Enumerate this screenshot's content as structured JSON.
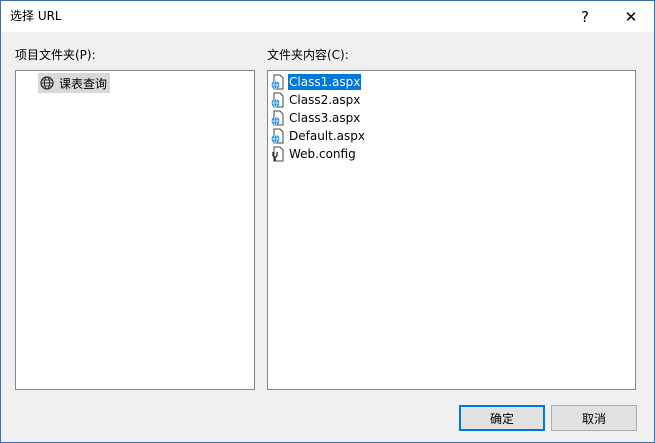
{
  "window": {
    "title": "选择 URL",
    "help_glyph": "?",
    "close_glyph": "✕"
  },
  "left": {
    "label": "项目文件夹(P):",
    "tree": [
      {
        "label": "课表查询",
        "icon": "globe-icon",
        "highlighted": true
      }
    ]
  },
  "right": {
    "label": "文件夹内容(C):",
    "files": [
      {
        "name": "Class1.aspx",
        "icon": "aspx-file-icon",
        "selected": true
      },
      {
        "name": "Class2.aspx",
        "icon": "aspx-file-icon",
        "selected": false
      },
      {
        "name": "Class3.aspx",
        "icon": "aspx-file-icon",
        "selected": false
      },
      {
        "name": "Default.aspx",
        "icon": "aspx-file-icon",
        "selected": false
      },
      {
        "name": "Web.config",
        "icon": "config-file-icon",
        "selected": false
      }
    ]
  },
  "buttons": {
    "ok": "确定",
    "cancel": "取消"
  },
  "colors": {
    "selection": "#0078d7",
    "border": "#828790",
    "dialog_bg": "#f0f0f0"
  }
}
